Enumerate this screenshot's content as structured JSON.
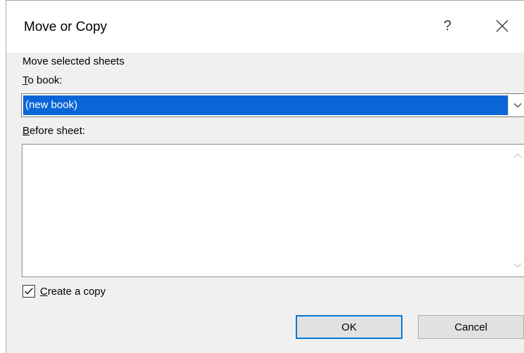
{
  "dialog": {
    "title": "Move or Copy",
    "help_label": "?",
    "close_icon": "close-icon"
  },
  "move_section": {
    "heading": "Move selected sheets",
    "to_book_label_mnemonic": "T",
    "to_book_label_rest": "o book:",
    "to_book_value": "(new book)",
    "before_sheet_label_mnemonic": "B",
    "before_sheet_label_rest": "efore sheet:",
    "before_sheet_items": []
  },
  "options": {
    "create_copy_mnemonic": "C",
    "create_copy_rest": "reate a copy",
    "create_copy_checked": true
  },
  "buttons": {
    "ok_label": "OK",
    "cancel_label": "Cancel"
  },
  "colors": {
    "selection": "#0a66d6",
    "focus_border": "#0078d7",
    "dialog_bg": "#f0f0f0"
  }
}
